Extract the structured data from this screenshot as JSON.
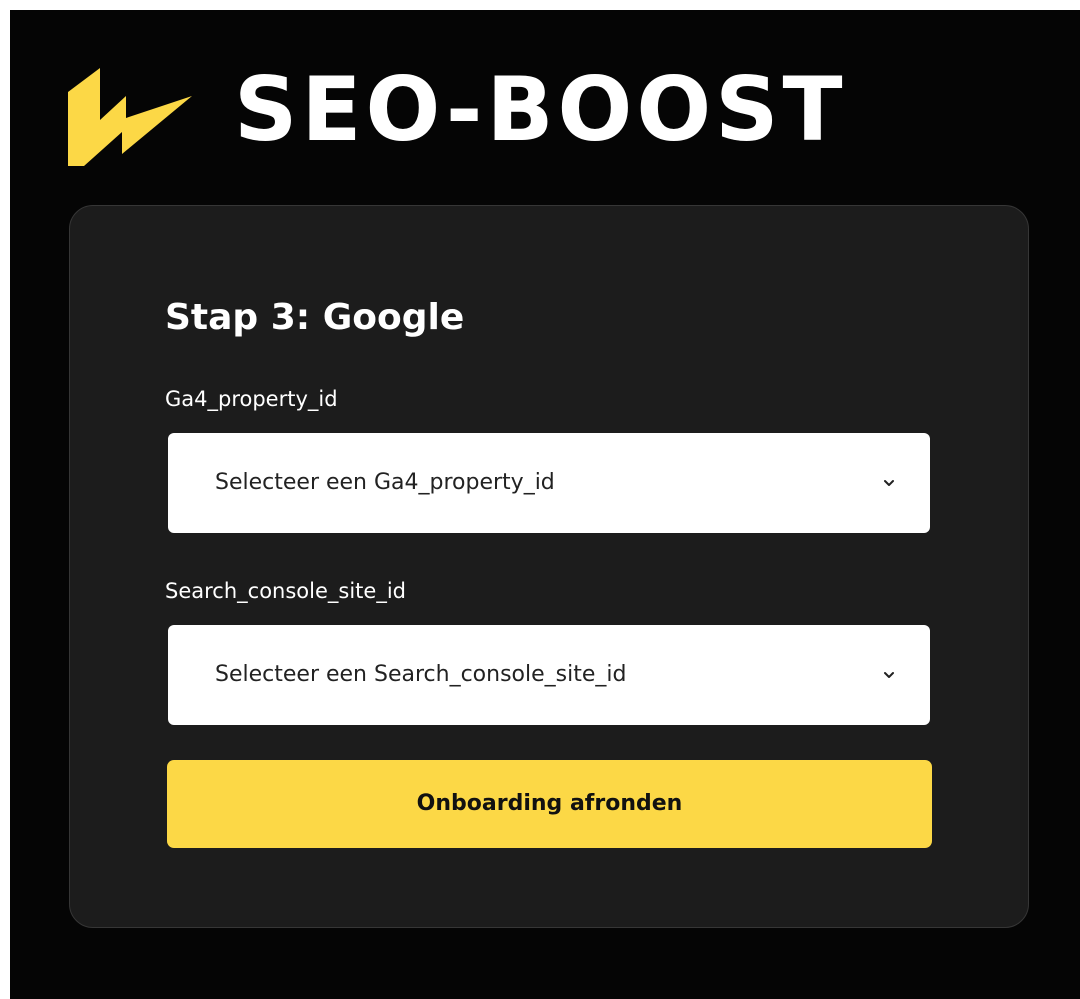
{
  "brand": {
    "name": "SEO-BOOST",
    "logo_icon": "lightning-bolt-icon",
    "accent_color": "#FCD846"
  },
  "form": {
    "title": "Stap 3: Google",
    "fields": [
      {
        "label": "Ga4_property_id",
        "selected_value": "Selecteer een Ga4_property_id"
      },
      {
        "label": "Search_console_site_id",
        "selected_value": "Selecteer een Search_console_site_id"
      }
    ],
    "submit_label": "Onboarding afronden"
  }
}
